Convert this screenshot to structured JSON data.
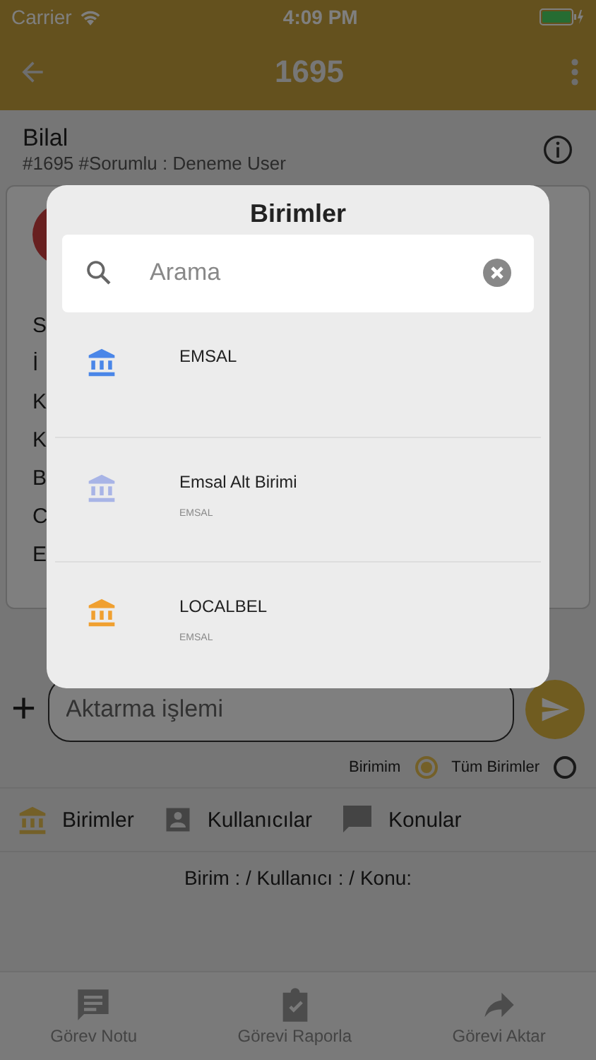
{
  "status_bar": {
    "carrier": "Carrier",
    "time": "4:09 PM"
  },
  "header": {
    "title": "1695"
  },
  "task": {
    "name": "Bilal",
    "meta": "#1695 #Sorumlu : Deneme User"
  },
  "card": {
    "fragments": [
      "S",
      "İ",
      "K",
      "K",
      "B",
      "C",
      "E"
    ]
  },
  "message_input": {
    "add_symbol": "+",
    "placeholder": "Aktarma işlemi"
  },
  "scope": [
    {
      "label": "Birimim",
      "selected": true
    },
    {
      "label": "Tüm Birimler",
      "selected": false
    }
  ],
  "tabs": [
    {
      "label": "Birimler",
      "kind": "unit",
      "selected": true
    },
    {
      "label": "Kullanıcılar",
      "kind": "user",
      "selected": false
    },
    {
      "label": "Konular",
      "kind": "topic",
      "selected": false
    }
  ],
  "summary": "Birim : / Kullanıcı :  / Konu:",
  "bottom_nav": [
    {
      "label": "Görev Notu",
      "kind": "note"
    },
    {
      "label": "Görevi Raporla",
      "kind": "report"
    },
    {
      "label": "Görevi Aktar",
      "kind": "forward"
    }
  ],
  "dialog": {
    "title": "Birimler",
    "search": {
      "placeholder": "Arama"
    },
    "items": [
      {
        "name": "EMSAL",
        "color": "#4a86e8"
      },
      {
        "name": "Emsal Alt Birimi",
        "parent": "EMSAL",
        "color": "#a8b4e6"
      },
      {
        "name": "LOCALBEL",
        "parent": "EMSAL",
        "color": "#f0a030"
      }
    ]
  }
}
